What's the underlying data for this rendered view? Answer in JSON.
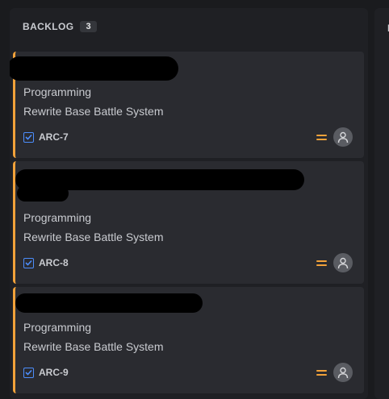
{
  "column": {
    "title": "BACKLOG",
    "count": "3",
    "next_column_label": "I"
  },
  "cards": [
    {
      "title": "",
      "category": "Programming",
      "summary": "Rewrite Base Battle System",
      "key": "ARC-7",
      "type_icon": "task-checkbox-icon",
      "priority_icon": "priority-medium-icon",
      "assignee_icon": "unassigned-avatar-icon"
    },
    {
      "title": "",
      "category": "Programming",
      "summary": "Rewrite Base Battle System",
      "key": "ARC-8",
      "type_icon": "task-checkbox-icon",
      "priority_icon": "priority-medium-icon",
      "assignee_icon": "unassigned-avatar-icon"
    },
    {
      "title": "",
      "category": "Programming",
      "summary": "Rewrite Base Battle System",
      "key": "ARC-9",
      "type_icon": "task-checkbox-icon",
      "priority_icon": "priority-medium-icon",
      "assignee_icon": "unassigned-avatar-icon"
    }
  ],
  "colors": {
    "accent": "#f2a23a",
    "task_icon": "#4c8dfb",
    "card_bg": "#2a2b30",
    "column_bg": "#1f2024"
  }
}
